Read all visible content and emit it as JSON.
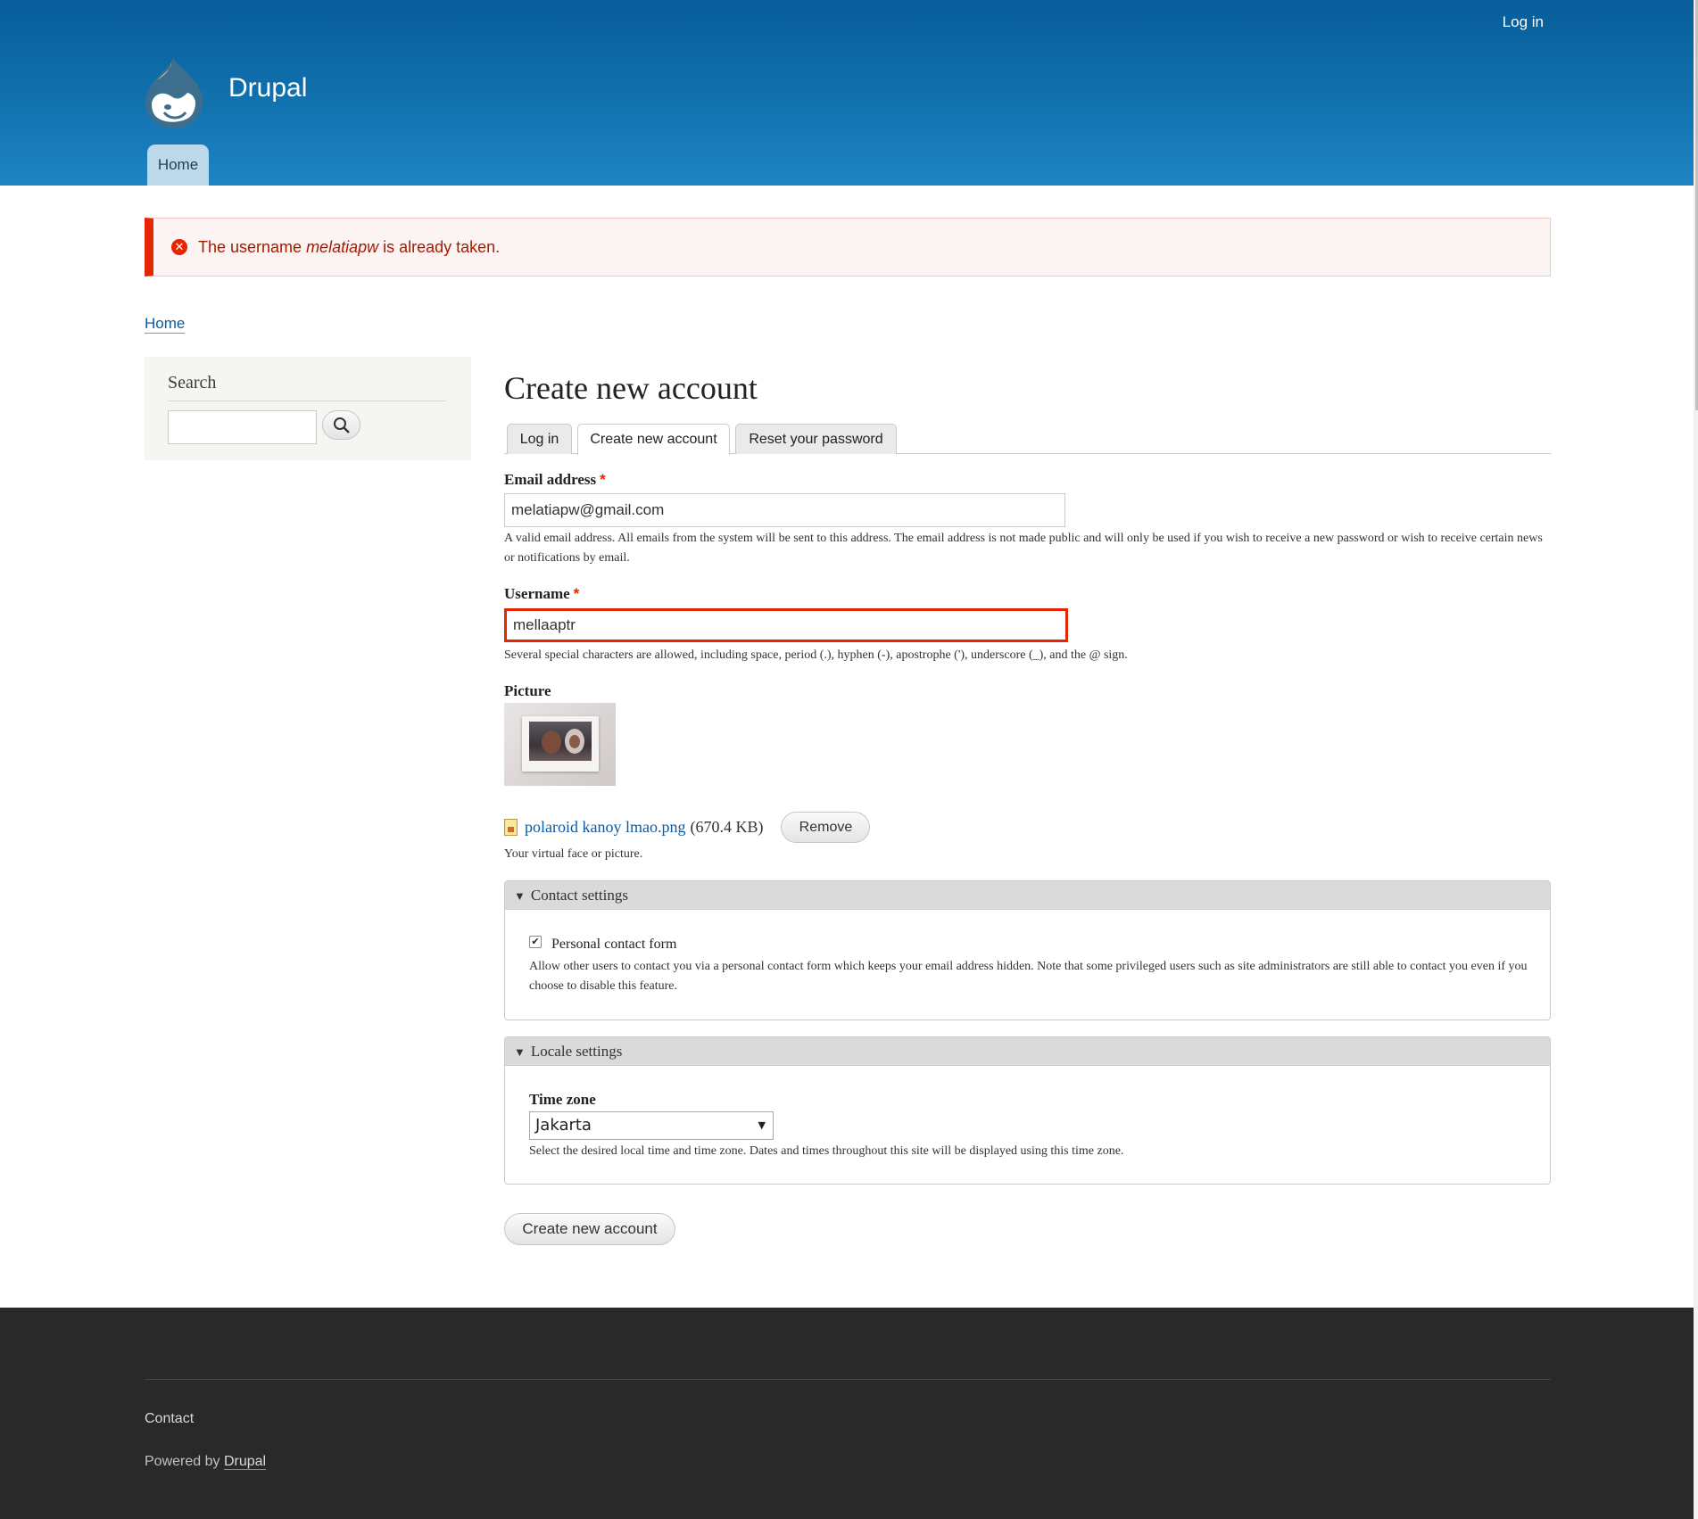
{
  "header": {
    "login_link": "Log in",
    "site_name": "Drupal",
    "nav_home": "Home"
  },
  "message": {
    "prefix": "The username",
    "username": "melatiapw",
    "suffix": "is already taken."
  },
  "breadcrumb": {
    "home": "Home"
  },
  "sidebar": {
    "title": "Search",
    "search_value": "",
    "search_icon": "magnifier-icon"
  },
  "page": {
    "title": "Create new account",
    "tabs": [
      {
        "label": "Log in",
        "active": false
      },
      {
        "label": "Create new account",
        "active": true
      },
      {
        "label": "Reset your password",
        "active": false
      }
    ]
  },
  "form": {
    "email": {
      "label": "Email address",
      "required": "*",
      "value": "melatiapw@gmail.com",
      "description": "A valid email address. All emails from the system will be sent to this address. The email address is not made public and will only be used if you wish to receive a new password or wish to receive certain news or notifications by email."
    },
    "username": {
      "label": "Username",
      "required": "*",
      "value": "mellaaptr",
      "description": "Several special characters are allowed, including space, period (.), hyphen (-), apostrophe ('), underscore (_), and the @ sign."
    },
    "picture": {
      "label": "Picture",
      "file_name": "polaroid kanoy lmao.png",
      "file_size": "(670.4 KB)",
      "remove_label": "Remove",
      "description": "Your virtual face or picture."
    },
    "contact": {
      "summary": "Contact settings",
      "checkbox_label": "Personal contact form",
      "checked": true,
      "description": "Allow other users to contact you via a personal contact form which keeps your email address hidden. Note that some privileged users such as site administrators are still able to contact you even if you choose to disable this feature."
    },
    "locale": {
      "summary": "Locale settings",
      "timezone_label": "Time zone",
      "timezone_value": "Jakarta",
      "description": "Select the desired local time and time zone. Dates and times throughout this site will be displayed using this time zone."
    },
    "submit_label": "Create new account"
  },
  "footer": {
    "contact": "Contact",
    "powered_prefix": "Powered by",
    "powered_link": "Drupal"
  },
  "colors": {
    "header_top": "#075d99",
    "header_bottom": "#1f84c3",
    "error": "#e62600",
    "link": "#0b5b9f",
    "footer_bg": "#292929"
  }
}
